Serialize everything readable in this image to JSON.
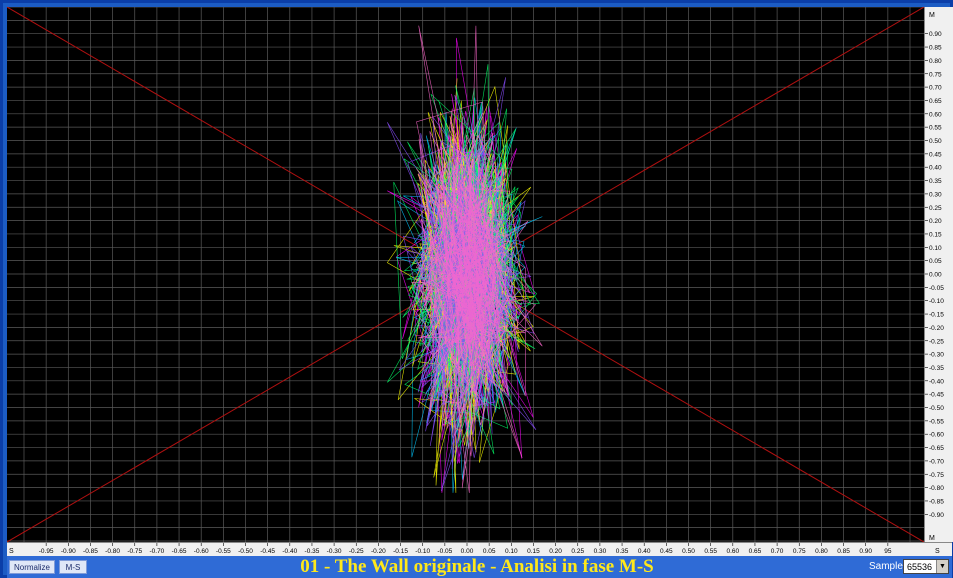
{
  "title": "01 - The Wall originale - Analisi in fase M-S",
  "buttons": {
    "normalize": "Normalize",
    "ms": "M-S"
  },
  "samples": {
    "label": "Samples",
    "value": "65536"
  },
  "axes": {
    "y_top_label": "M",
    "y_bottom_label": "M",
    "x_left_label": "S",
    "x_right_label": "S",
    "y_ticks": [
      "0.90",
      "0.85",
      "0.80",
      "0.75",
      "0.70",
      "0.65",
      "0.60",
      "0.55",
      "0.50",
      "0.45",
      "0.40",
      "0.35",
      "0.30",
      "0.25",
      "0.20",
      "0.15",
      "0.10",
      "0.05",
      "0.00",
      "-0.05",
      "-0.10",
      "-0.15",
      "-0.20",
      "-0.25",
      "-0.30",
      "-0.35",
      "-0.40",
      "-0.45",
      "-0.50",
      "-0.55",
      "-0.60",
      "-0.65",
      "-0.70",
      "-0.75",
      "-0.80",
      "-0.85",
      "-0.90"
    ],
    "x_ticks": [
      "-0.95",
      "-0.90",
      "-0.85",
      "-0.80",
      "-0.75",
      "-0.70",
      "-0.65",
      "-0.60",
      "-0.55",
      "-0.50",
      "-0.45",
      "-0.40",
      "-0.35",
      "-0.30",
      "-0.25",
      "-0.20",
      "-0.15",
      "-0.10",
      "-0.05",
      "0.00",
      "0.05",
      "0.10",
      "0.15",
      "0.20",
      "0.25",
      "0.30",
      "0.35",
      "0.40",
      "0.45",
      "0.50",
      "0.55",
      "0.60",
      "0.65",
      "0.70",
      "0.75",
      "0.80",
      "0.85",
      "0.90",
      "95"
    ]
  },
  "colors": {
    "grid": "#5a5a5a",
    "diagonal": "#b01010",
    "trace": [
      "#ff00ff",
      "#00c8ff",
      "#ffff00",
      "#00ff66",
      "#8a4cff",
      "#ff66cc"
    ]
  },
  "chart_data": {
    "type": "scatter",
    "xlabel": "S",
    "ylabel": "M",
    "xlim": [
      -1.0,
      1.0
    ],
    "ylim": [
      -1.0,
      1.0
    ],
    "grid": true,
    "cluster": {
      "center": [
        0.0,
        0.0
      ],
      "x_spread": [
        -0.18,
        0.17
      ],
      "y_spread": [
        -0.82,
        0.93
      ]
    }
  }
}
